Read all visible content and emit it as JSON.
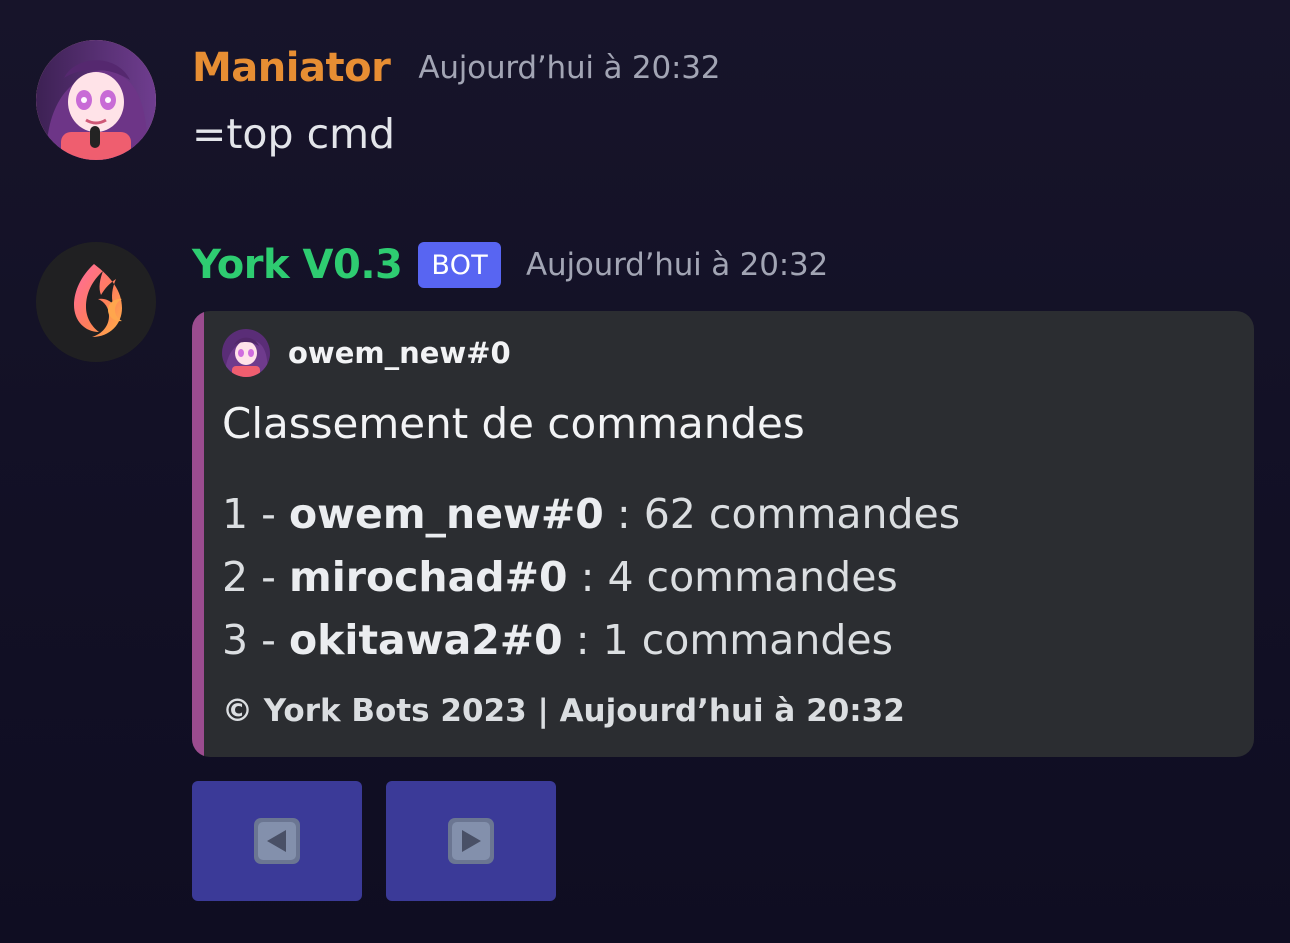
{
  "colors": {
    "background": "#17142a",
    "maniator_name": "#e78e33",
    "york_name": "#2ecc71",
    "timestamp": "#a2a5b4",
    "bot_badge": "#5865f2",
    "embed_bg": "#2b2d31",
    "embed_accent": "#9b4c8f",
    "button_bg": "#3b3a98"
  },
  "messages": {
    "first": {
      "username": "Maniator",
      "timestamp": "Aujourd’hui à 20:32",
      "content": "=top cmd",
      "avatar_icon": "anime-character-avatar"
    },
    "second": {
      "username": "York V0.3",
      "badge": "BOT",
      "timestamp": "Aujourd’hui à 20:32",
      "avatar_icon": "york-flame-logo",
      "embed": {
        "author": "owem_new#0",
        "author_icon": "anime-character-avatar",
        "title": "Classement de commandes",
        "rows": [
          {
            "rank": "1",
            "name": "owem_new#0",
            "value": "62 commandes"
          },
          {
            "rank": "2",
            "name": "mirochad#0",
            "value": "4 commandes"
          },
          {
            "rank": "3",
            "name": "okitawa2#0",
            "value": "1 commandes"
          }
        ],
        "footer": "© York Bots 2023 | Aujourd’hui à 20:32"
      },
      "buttons": [
        {
          "icon": "left-arrow-icon"
        },
        {
          "icon": "right-arrow-icon"
        }
      ]
    }
  }
}
